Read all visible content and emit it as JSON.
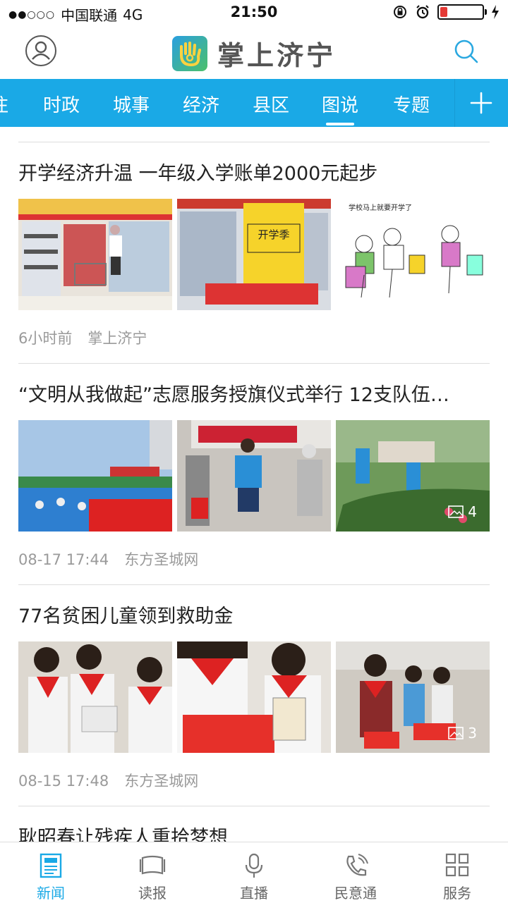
{
  "status_bar": {
    "carrier": "中国联通",
    "network": "4G",
    "time": "21:50"
  },
  "header": {
    "app_name": "掌上济宁"
  },
  "channels": [
    {
      "label": "注"
    },
    {
      "label": "时政"
    },
    {
      "label": "城事"
    },
    {
      "label": "经济"
    },
    {
      "label": "县区"
    },
    {
      "label": "图说",
      "active": true
    },
    {
      "label": "专题"
    }
  ],
  "articles": [
    {
      "title": "开学经济升温 一年级入学账单2000元起步",
      "time": "6小时前",
      "source": "掌上济宁",
      "image_count": ""
    },
    {
      "title": "“文明从我做起”志愿服务授旗仪式举行 12支队伍…",
      "time": "08-17 17:44",
      "source": "东方圣城网",
      "image_count": "4"
    },
    {
      "title": "77名贫困儿童领到救助金",
      "time": "08-15 17:48",
      "source": "东方圣城网",
      "image_count": "3"
    },
    {
      "title": "耿昭春让残疾人重拾梦想"
    }
  ],
  "images": {
    "a1_3_caption": "学校马上就要开学了",
    "a1_2_sign": "开学季"
  },
  "bottom_nav": [
    {
      "label": "新闻",
      "icon": "news-icon",
      "active": true
    },
    {
      "label": "读报",
      "icon": "newspaper-icon"
    },
    {
      "label": "直播",
      "icon": "microphone-icon"
    },
    {
      "label": "民意通",
      "icon": "phone-icon"
    },
    {
      "label": "服务",
      "icon": "grid-icon"
    }
  ],
  "colors": {
    "accent": "#1aa9e6",
    "meta_text": "#9a9a9a"
  }
}
